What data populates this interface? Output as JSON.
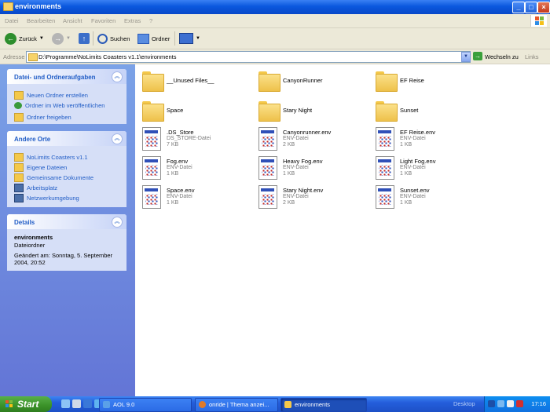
{
  "window": {
    "title": "environments"
  },
  "menu": [
    "Datei",
    "Bearbeiten",
    "Ansicht",
    "Favoriten",
    "Extras",
    "?"
  ],
  "toolbar": {
    "back_label": "Zurück",
    "search_label": "Suchen",
    "folders_label": "Ordner"
  },
  "address": {
    "label": "Adresse",
    "value": "D:\\Programme\\NoLimits Coasters v1.1\\environments",
    "go_label": "Wechseln zu",
    "links_label": "Links"
  },
  "tasks_panel": {
    "title": "Datei- und Ordneraufgaben",
    "items": [
      "Neuen Ordner erstellen",
      "Ordner im Web veröffentlichen",
      "Ordner freigeben"
    ]
  },
  "places_panel": {
    "title": "Andere Orte",
    "items": [
      "NoLimits Coasters v1.1",
      "Eigene Dateien",
      "Gemeinsame Dokumente",
      "Arbeitsplatz",
      "Netzwerkumgebung"
    ]
  },
  "details_panel": {
    "title": "Details",
    "name": "environments",
    "type": "Dateiordner",
    "modified_line1": "Geändert am: Sonntag, 5. September",
    "modified_line2": "2004, 20:52"
  },
  "files": [
    {
      "name": "__Unused Files__",
      "kind": "folder"
    },
    {
      "name": "CanyonRunner",
      "kind": "folder"
    },
    {
      "name": "EF Reise",
      "kind": "folder"
    },
    {
      "name": "Space",
      "kind": "folder"
    },
    {
      "name": "Stary Night",
      "kind": "folder"
    },
    {
      "name": "Sunset",
      "kind": "folder"
    },
    {
      "name": ".DS_Store",
      "kind": "file",
      "type": "DS_STORE-Datei",
      "size": "7 KB"
    },
    {
      "name": "Canyonrunner.env",
      "kind": "file",
      "type": "ENV-Datei",
      "size": "2 KB"
    },
    {
      "name": "EF Reise.env",
      "kind": "file",
      "type": "ENV-Datei",
      "size": "1 KB"
    },
    {
      "name": "Fog.env",
      "kind": "file",
      "type": "ENV-Datei",
      "size": "1 KB"
    },
    {
      "name": "Heavy Fog.env",
      "kind": "file",
      "type": "ENV-Datei",
      "size": "1 KB"
    },
    {
      "name": "Light Fog.env",
      "kind": "file",
      "type": "ENV-Datei",
      "size": "1 KB"
    },
    {
      "name": "Space.env",
      "kind": "file",
      "type": "ENV-Datei",
      "size": "1 KB"
    },
    {
      "name": "Stary Night.env",
      "kind": "file",
      "type": "ENV-Datei",
      "size": "2 KB"
    },
    {
      "name": "Sunset.env",
      "kind": "file",
      "type": "ENV-Datei",
      "size": "1 KB"
    }
  ],
  "taskbar": {
    "start_label": "Start",
    "tasks": [
      "AOL 9.0",
      "onride | Thema anzei...",
      "environments"
    ],
    "desktop_label": "Desktop",
    "clock": "17:16"
  },
  "colors": {
    "accent": "#245edb",
    "panel_text": "#215dc6",
    "start_green": "#3a9128"
  }
}
